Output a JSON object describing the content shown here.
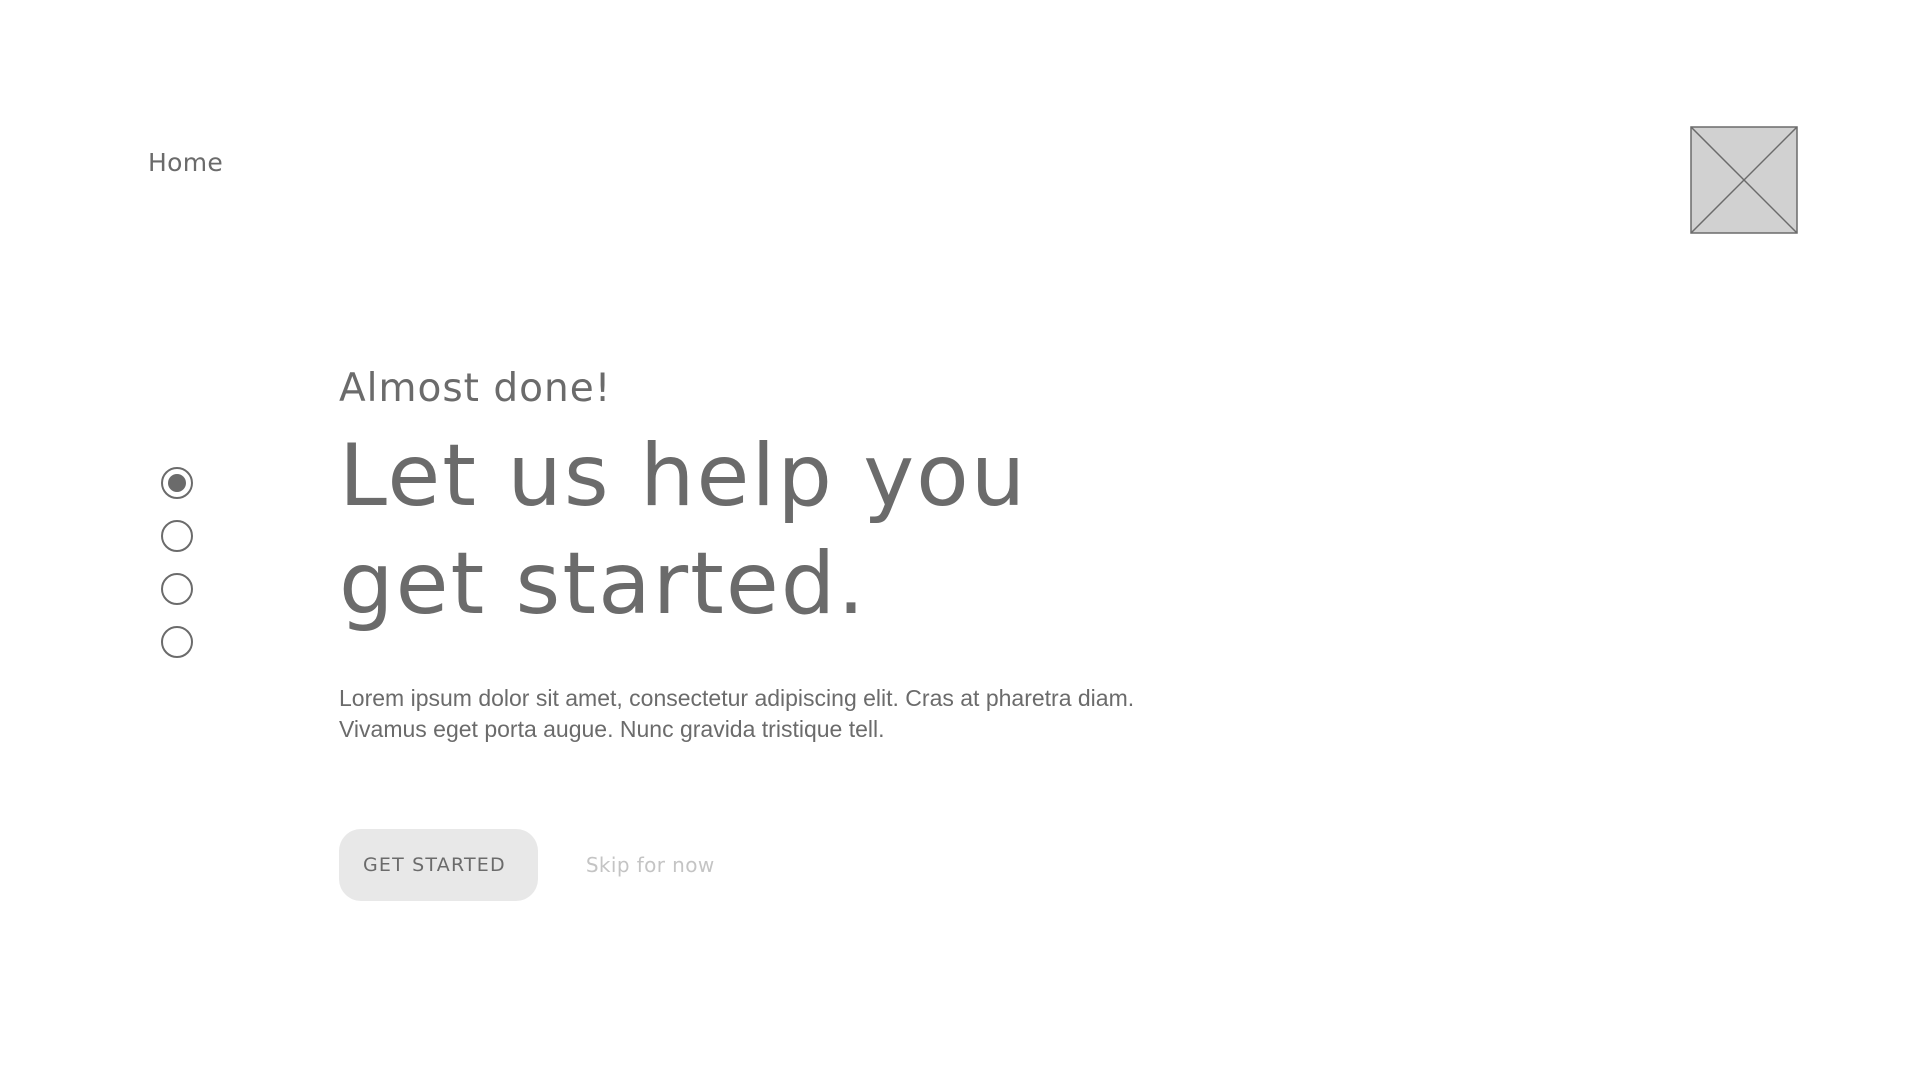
{
  "nav": {
    "home_label": "Home"
  },
  "logo": {
    "icon": "image-placeholder-icon",
    "fill_color": "#d1d1d1",
    "stroke_color": "#6b6b6b"
  },
  "steps": {
    "total": 4,
    "current": 1,
    "items": [
      {
        "state": "active"
      },
      {
        "state": "inactive"
      },
      {
        "state": "inactive"
      },
      {
        "state": "inactive"
      }
    ]
  },
  "hero": {
    "eyebrow": "Almost done!",
    "headline_line1": "Let us help you",
    "headline_line2": "get started.",
    "body_line1": "Lorem ipsum dolor sit amet, consectetur adipiscing elit. Cras at pharetra diam.",
    "body_line2": "Vivamus eget porta augue. Nunc gravida tristique tell."
  },
  "actions": {
    "primary_label": "GET STARTED",
    "secondary_label": "Skip for now"
  },
  "colors": {
    "text": "#6b6b6b",
    "muted_text": "#c4c4c4",
    "button_bg": "#e8e8e8",
    "background": "#ffffff"
  }
}
